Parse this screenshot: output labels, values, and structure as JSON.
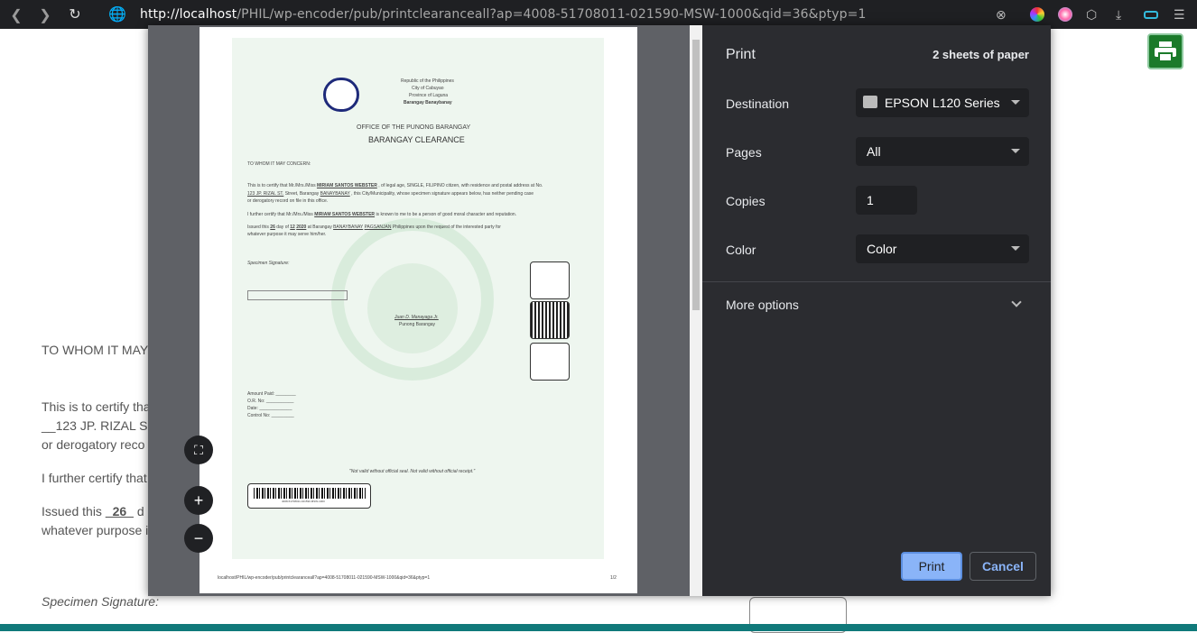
{
  "browser": {
    "url_host": "http://localhost",
    "url_rest": "/PHIL/wp-encoder/pub/printclearanceall?ap=4008-51708011-021590-MSW-1000&qid=36&ptyp=1"
  },
  "background": {
    "to_whom": "TO WHOM IT MAY",
    "certify": "This is to certify tha",
    "address": "__123 JP. RIZAL S",
    "derog": "or derogatory reco",
    "further": "I further certify that",
    "issued": "Issued this",
    "issued_day": "_26_",
    "issued_tail": "d",
    "whatever": "whatever purpose i",
    "specimen": "Specimen Signature:"
  },
  "print": {
    "title": "Print",
    "sheets": "2 sheets of paper",
    "destination_label": "Destination",
    "destination_value": "EPSON L120 Series",
    "pages_label": "Pages",
    "pages_value": "All",
    "copies_label": "Copies",
    "copies_value": "1",
    "color_label": "Color",
    "color_value": "Color",
    "more_options": "More options",
    "print_button": "Print",
    "cancel_button": "Cancel"
  },
  "document": {
    "republic": "Republic of the Philippines",
    "city": "City of Cabuyao",
    "province": "Province of Laguna",
    "barangay": "Barangay Banaybanay",
    "office": "OFFICE OF THE PUNONG BARANGAY",
    "clearance_title": "BARANGAY CLEARANCE",
    "to_whom": "TO WHOM IT MAY CONCERN:",
    "para1a": "This is to certify that Mr./Mrs./Miss",
    "name": "MIRIAM SANTOS WEBSTER",
    "para1b": ", of legal age, SINGLE, FILIPINO citizen, with residence and postal address at No.",
    "para1_address": "123 JP. RIZAL ST.",
    "para1c": "Street, Barangay",
    "para1_brgy": "BANAYBANAY",
    "para1d": ", this City/Municipality, whose specimen signature appears below, has neither pending case",
    "para1e": "or derogatory record on file in this office.",
    "para2a": "I further certify that Mr./Mrs./Miss",
    "para2b": "is known to me to be a person of good moral character and reputation.",
    "para3a": "Issued this",
    "para3_day": "26",
    "para3b": "day of",
    "para3_month": "12",
    "para3_year": "2020",
    "para3c": "at Barangay",
    "para3_brgy": "BANAYBANAY",
    "para3_city": "PAGSANJAN",
    "para3d": "Philippines upon the request of the interested party for",
    "para3e": "whatever purpose it may serve him/her.",
    "specimen": "Specimen Signature:",
    "captain": "Juan D. Manayaga Jr.",
    "captain_title": "Punong Barangay",
    "amount_paid": "Amount Paid: ________",
    "or_no": "O.R. No: ___________",
    "date": "Date: _____________",
    "control_no": "Control No: _________",
    "not_valid": "\"Not valid without official seal. Not valid without official receipt.\"",
    "barcode_text": "4008-51708011-021590-MSW-1000",
    "footer_url": "localhost/PHIL/wp-encoder/pub/printclearanceall?ap=4008-51708011-021590-MSW-1000&qid=36&ptyp=1",
    "page_no": "1/2"
  }
}
